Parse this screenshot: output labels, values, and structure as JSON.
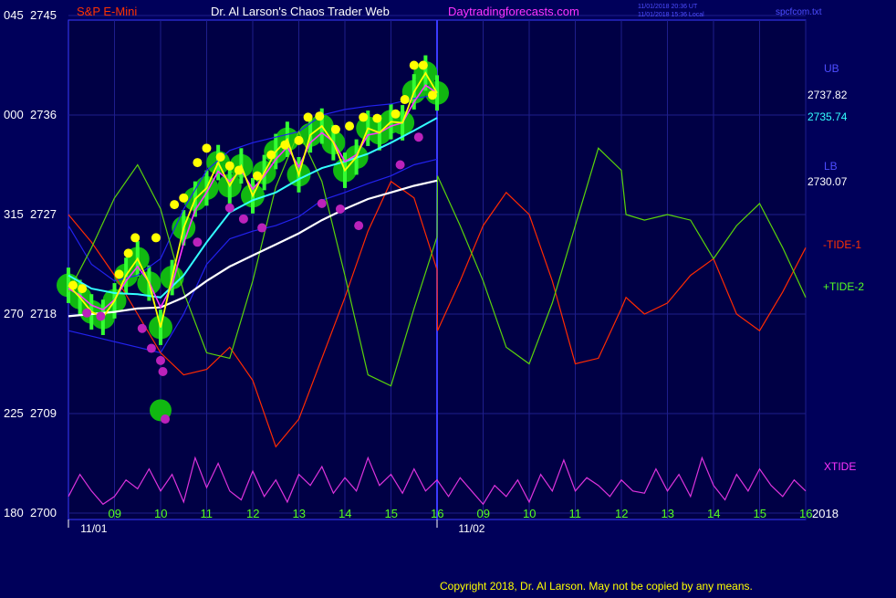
{
  "header": {
    "symbol": "S&P E-Mini",
    "title": "Dr. Al Larson's Chaos Trader Web",
    "site": "Daytradingforecasts.com",
    "timestamp_utc": "11/01/2018 20:36 UT",
    "timestamp_local": "11/01/2018 15:36 Local",
    "filename": "spcfcom.txt"
  },
  "footer": {
    "copyright": "Copyright 2018, Dr. Al Larson. May not be copied by any means."
  },
  "colors": {
    "background": "#00005a",
    "plot_background": "#000045",
    "grid": "#1e1e8c",
    "axis": "#3a3aff",
    "price": "#ffff00",
    "price_band": "#11b811",
    "bright_green": "#33ff33",
    "ma_fast": "#ff33ff",
    "ma_cyan": "#33ffff",
    "ma_white": "#ffffff",
    "tide1": "#ff2a00",
    "tide2": "#5ad40a",
    "xtide": "#dd33dd",
    "label_red": "#ff3300",
    "label_green": "#55ff22",
    "label_blue": "#4d4dff",
    "label_magenta": "#ff33ff",
    "band_blue": "#2222ee"
  },
  "chart_data": {
    "type": "line",
    "title": "S&P E-Mini",
    "y_ticks": [
      {
        "value": 2745,
        "left": "045"
      },
      {
        "value": 2736,
        "left": "000"
      },
      {
        "value": 2727,
        "left": "315"
      },
      {
        "value": 2718,
        "left": "270"
      },
      {
        "value": 2709,
        "left": "225"
      },
      {
        "value": 2700,
        "left": "180"
      }
    ],
    "ylim": [
      2700,
      2745
    ],
    "x_ticks": [
      {
        "label": "09",
        "hour": 9
      },
      {
        "label": "10",
        "hour": 10
      },
      {
        "label": "11",
        "hour": 11
      },
      {
        "label": "12",
        "hour": 12
      },
      {
        "label": "13",
        "hour": 13
      },
      {
        "label": "14",
        "hour": 14
      },
      {
        "label": "15",
        "hour": 15
      },
      {
        "label": "16",
        "hour": 16
      },
      {
        "label": "09",
        "hour": 17
      },
      {
        "label": "10",
        "hour": 18
      },
      {
        "label": "11",
        "hour": 19
      },
      {
        "label": "12",
        "hour": 20
      },
      {
        "label": "13",
        "hour": 21
      },
      {
        "label": "14",
        "hour": 22
      },
      {
        "label": "15",
        "hour": 23
      },
      {
        "label": "16",
        "hour": 24
      }
    ],
    "x_ticks_note": "Hours 17-24 represent 09-16 on 11/02",
    "xlim": [
      8.0,
      24.0
    ],
    "date_labels": [
      {
        "label": "11/01",
        "hour": 8.5
      },
      {
        "label": "11/02",
        "hour": 16.7
      }
    ],
    "year_label": "2018",
    "right_labels": {
      "ub": "UB",
      "ub_value": "2737.82",
      "cyan_value": "2735.74",
      "lb": "LB",
      "lb_value": "2730.07",
      "tide1": "-TIDE-1",
      "tide2": "+TIDE-2",
      "xtide": "XTIDE"
    },
    "price": {
      "x": [
        8.0,
        8.25,
        8.5,
        8.75,
        9.0,
        9.25,
        9.5,
        9.75,
        10.0,
        10.25,
        10.5,
        10.75,
        11.0,
        11.25,
        11.5,
        11.75,
        12.0,
        12.25,
        12.5,
        12.75,
        13.0,
        13.25,
        13.5,
        13.75,
        14.0,
        14.25,
        14.5,
        14.75,
        15.0,
        15.25,
        15.5,
        15.75,
        16.0
      ],
      "y": [
        2720.6,
        2719.5,
        2718.2,
        2717.7,
        2719.2,
        2721.5,
        2723.0,
        2720.8,
        2716.8,
        2721.3,
        2725.8,
        2728.4,
        2729.4,
        2731.7,
        2729.6,
        2731.4,
        2728.7,
        2730.8,
        2732.7,
        2733.8,
        2730.6,
        2734.2,
        2735.0,
        2733.5,
        2731.0,
        2732.2,
        2734.8,
        2734.4,
        2735.4,
        2735.3,
        2738.1,
        2739.8,
        2738.0
      ]
    },
    "series": [
      {
        "name": "ma_fast",
        "x": [
          8.0,
          8.25,
          8.5,
          8.75,
          9.0,
          9.25,
          9.5,
          9.75,
          10.0,
          10.25,
          10.5,
          10.75,
          11.0,
          11.25,
          11.5,
          11.75,
          12.0,
          12.25,
          12.5,
          12.75,
          13.0,
          13.25,
          13.5,
          13.75,
          14.0,
          14.25,
          14.5,
          14.75,
          15.0,
          15.25,
          15.5,
          15.75,
          16.0
        ],
        "y": [
          2720.3,
          2719.7,
          2718.8,
          2718.4,
          2719.3,
          2721.0,
          2722.3,
          2720.9,
          2718.6,
          2720.6,
          2724.4,
          2727.4,
          2729.0,
          2730.9,
          2730.0,
          2731.0,
          2729.3,
          2730.5,
          2732.0,
          2733.1,
          2731.3,
          2733.5,
          2734.4,
          2733.6,
          2731.8,
          2732.4,
          2734.2,
          2734.4,
          2735.0,
          2735.3,
          2737.2,
          2738.7,
          2738.0
        ]
      },
      {
        "name": "ma_cyan",
        "x": [
          8.0,
          8.5,
          9.0,
          9.5,
          10.0,
          10.5,
          11.0,
          11.5,
          12.0,
          12.5,
          13.0,
          13.5,
          14.0,
          14.5,
          15.0,
          15.5,
          16.0
        ],
        "y": [
          2721.5,
          2720.3,
          2719.9,
          2719.8,
          2719.5,
          2721.5,
          2724.5,
          2727.2,
          2728.3,
          2729.0,
          2730.2,
          2731.2,
          2731.8,
          2732.5,
          2733.5,
          2734.6,
          2735.74
        ]
      },
      {
        "name": "ma_white",
        "x": [
          8.0,
          8.5,
          9.0,
          9.5,
          10.0,
          10.5,
          11.0,
          11.5,
          12.0,
          12.5,
          13.0,
          13.5,
          14.0,
          14.5,
          15.0,
          15.5,
          16.0
        ],
        "y": [
          2717.8,
          2718.0,
          2718.2,
          2718.5,
          2718.6,
          2719.5,
          2721.0,
          2722.3,
          2723.3,
          2724.3,
          2725.3,
          2726.5,
          2727.5,
          2728.4,
          2729.0,
          2729.6,
          2730.07
        ]
      },
      {
        "name": "upper_band",
        "x": [
          8.0,
          8.5,
          9.0,
          9.5,
          10.0,
          10.5,
          11.0,
          11.5,
          12.0,
          12.5,
          13.0,
          13.5,
          14.0,
          14.5,
          15.0,
          15.5,
          16.0
        ],
        "y": [
          2726.0,
          2722.5,
          2721.0,
          2721.5,
          2723.0,
          2727.5,
          2731.0,
          2732.8,
          2733.5,
          2734.0,
          2734.5,
          2736.0,
          2736.5,
          2736.8,
          2737.0,
          2737.5,
          2737.82
        ]
      },
      {
        "name": "lower_band",
        "x": [
          8.0,
          8.5,
          9.0,
          9.5,
          10.0,
          10.5,
          11.0,
          11.5,
          12.0,
          12.5,
          13.0,
          13.5,
          14.0,
          14.5,
          15.0,
          15.5,
          16.0
        ],
        "y": [
          2716.5,
          2716.0,
          2715.5,
          2715.0,
          2714.5,
          2718.0,
          2722.5,
          2724.8,
          2725.5,
          2726.0,
          2726.8,
          2728.3,
          2729.0,
          2729.8,
          2730.5,
          2731.5,
          2732.0
        ]
      },
      {
        "name": "-TIDE-1",
        "x": [
          8.0,
          8.5,
          9.0,
          9.5,
          10.0,
          10.5,
          11.0,
          11.5,
          12.0,
          12.5,
          13.0,
          13.5,
          14.0,
          14.5,
          15.0,
          15.5,
          16.0,
          16.01,
          16.5,
          17.0,
          17.5,
          18.0,
          18.5,
          19.0,
          19.5,
          20.0,
          20.1,
          20.5,
          21.0,
          21.5,
          22.0,
          22.5,
          23.0,
          23.5,
          24.0
        ],
        "y": [
          2727.0,
          2724.5,
          2721.5,
          2718.0,
          2714.5,
          2712.5,
          2713.0,
          2715.0,
          2712.0,
          2706.0,
          2708.5,
          2714.0,
          2719.5,
          2725.5,
          2730.0,
          2728.5,
          2722.0,
          2716.5,
          2721.0,
          2726.0,
          2729.0,
          2727.0,
          2721.0,
          2713.5,
          2714.0,
          2718.5,
          2719.5,
          2718.0,
          2719.0,
          2721.5,
          2723.0,
          2718.0,
          2716.5,
          2720.0,
          2724.0
        ]
      },
      {
        "name": "+TIDE-2",
        "x": [
          8.0,
          8.5,
          9.0,
          9.5,
          10.0,
          10.5,
          11.0,
          11.5,
          12.0,
          12.5,
          13.0,
          13.5,
          14.0,
          14.5,
          15.0,
          15.5,
          16.0,
          16.01,
          16.5,
          17.0,
          17.5,
          18.0,
          18.5,
          19.0,
          19.5,
          20.0,
          20.1,
          20.5,
          21.0,
          21.5,
          22.0,
          22.5,
          23.0,
          23.5,
          24.0
        ],
        "y": [
          2720.0,
          2724.0,
          2728.5,
          2731.5,
          2727.5,
          2720.0,
          2714.5,
          2714.0,
          2721.0,
          2729.5,
          2734.5,
          2730.0,
          2721.5,
          2712.5,
          2711.5,
          2718.5,
          2725.0,
          2730.5,
          2726.0,
          2721.0,
          2715.0,
          2713.5,
          2719.0,
          2726.0,
          2733.0,
          2731.0,
          2727.0,
          2726.5,
          2727.0,
          2726.5,
          2723.0,
          2726.0,
          2728.0,
          2724.0,
          2719.5
        ]
      },
      {
        "name": "XTIDE",
        "x": [
          8.0,
          8.25,
          8.5,
          8.75,
          9.0,
          9.25,
          9.5,
          9.75,
          10.0,
          10.25,
          10.5,
          10.75,
          11.0,
          11.25,
          11.5,
          11.75,
          12.0,
          12.25,
          12.5,
          12.75,
          13.0,
          13.25,
          13.5,
          13.75,
          14.0,
          14.25,
          14.5,
          14.75,
          15.0,
          15.25,
          15.5,
          15.75,
          16.0,
          16.25,
          16.5,
          16.75,
          17.0,
          17.25,
          17.5,
          17.75,
          18.0,
          18.25,
          18.5,
          18.75,
          19.0,
          19.25,
          19.5,
          19.75,
          20.0,
          20.25,
          20.5,
          20.75,
          21.0,
          21.25,
          21.5,
          21.75,
          22.0,
          22.25,
          22.5,
          22.75,
          23.0,
          23.25,
          23.5,
          23.75,
          24.0
        ],
        "y": [
          2701.5,
          2703.5,
          2702.0,
          2700.8,
          2701.5,
          2703.0,
          2702.2,
          2704.0,
          2702.0,
          2703.5,
          2701.0,
          2705.0,
          2702.3,
          2704.5,
          2702.0,
          2701.2,
          2703.8,
          2701.5,
          2703.0,
          2701.0,
          2703.5,
          2702.5,
          2704.2,
          2701.8,
          2703.2,
          2702.0,
          2705.0,
          2702.5,
          2703.5,
          2701.8,
          2704.0,
          2702.0,
          2703.0,
          2701.5,
          2703.2,
          2702.0,
          2700.8,
          2702.5,
          2701.5,
          2703.0,
          2701.0,
          2703.5,
          2702.0,
          2704.8,
          2702.0,
          2703.2,
          2702.5,
          2701.5,
          2703.0,
          2702.0,
          2701.8,
          2704.0,
          2702.0,
          2703.5,
          2701.5,
          2705.0,
          2702.5,
          2701.2,
          2703.5,
          2702.0,
          2704.0,
          2702.5,
          2701.5,
          2703.0,
          2702.0
        ]
      }
    ],
    "yellow_dots": [
      [
        8.1,
        2720.6
      ],
      [
        8.3,
        2720.3
      ],
      [
        9.1,
        2721.6
      ],
      [
        9.3,
        2723.5
      ],
      [
        9.45,
        2724.9
      ],
      [
        9.9,
        2724.9
      ],
      [
        10.3,
        2727.9
      ],
      [
        10.5,
        2728.5
      ],
      [
        10.8,
        2731.7
      ],
      [
        11.0,
        2733.0
      ],
      [
        11.3,
        2732.2
      ],
      [
        11.5,
        2731.4
      ],
      [
        11.7,
        2731.0
      ],
      [
        12.1,
        2730.5
      ],
      [
        12.4,
        2732.4
      ],
      [
        12.7,
        2733.3
      ],
      [
        13.0,
        2733.7
      ],
      [
        13.2,
        2735.8
      ],
      [
        13.45,
        2735.9
      ],
      [
        13.8,
        2734.7
      ],
      [
        14.1,
        2735.0
      ],
      [
        14.4,
        2735.8
      ],
      [
        14.7,
        2735.7
      ],
      [
        15.1,
        2736.1
      ],
      [
        15.3,
        2737.4
      ],
      [
        15.5,
        2740.5
      ],
      [
        15.7,
        2740.5
      ],
      [
        15.9,
        2737.8
      ]
    ],
    "magenta_dots": [
      [
        8.4,
        2718.1
      ],
      [
        8.7,
        2717.8
      ],
      [
        9.6,
        2716.7
      ],
      [
        9.8,
        2714.9
      ],
      [
        10.0,
        2713.8
      ],
      [
        10.05,
        2712.8
      ],
      [
        10.1,
        2708.5
      ],
      [
        10.8,
        2724.5
      ],
      [
        11.5,
        2727.6
      ],
      [
        11.8,
        2726.6
      ],
      [
        12.2,
        2725.8
      ],
      [
        13.5,
        2728.0
      ],
      [
        13.9,
        2727.5
      ],
      [
        14.3,
        2726.0
      ],
      [
        15.2,
        2731.5
      ],
      [
        15.6,
        2734.0
      ]
    ]
  }
}
